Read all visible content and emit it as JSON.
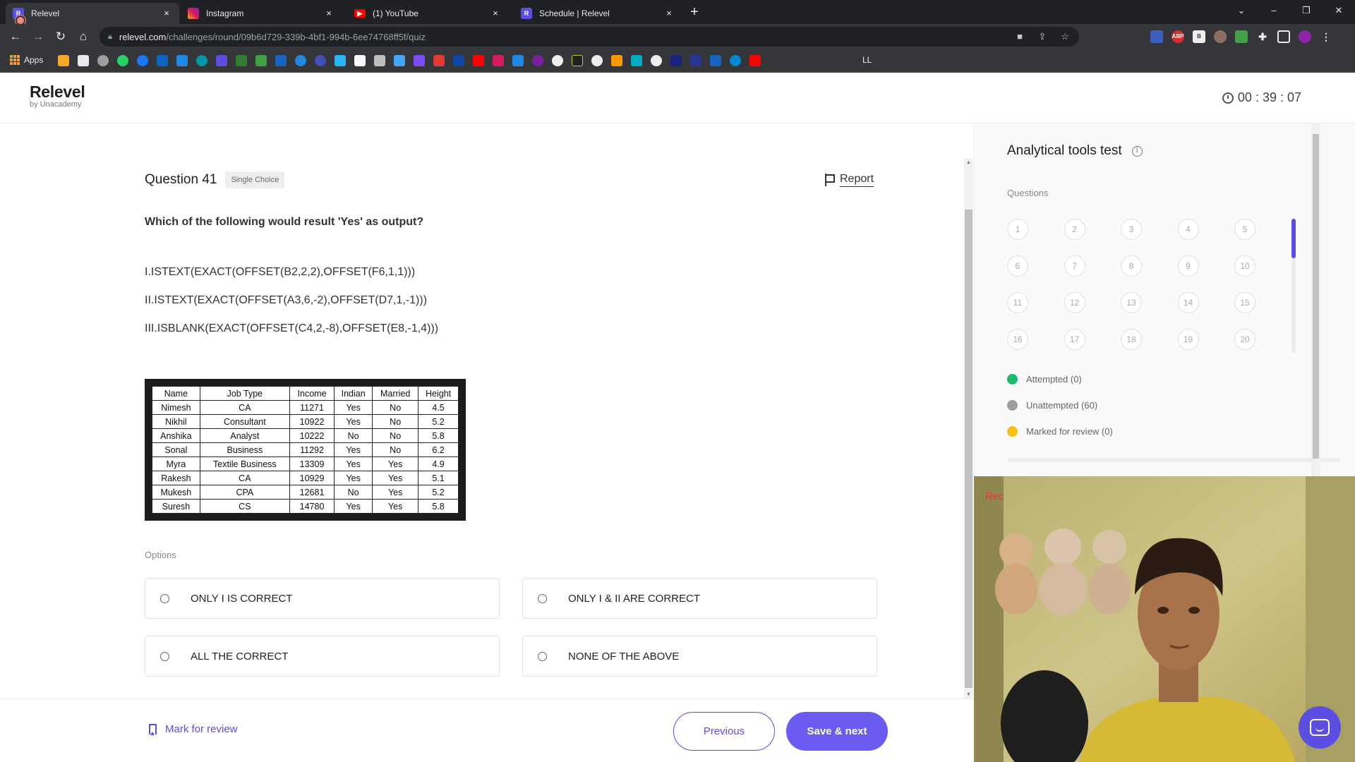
{
  "browser": {
    "tabs": [
      {
        "title": "Relevel",
        "favicon": "relevel-icon",
        "active": true,
        "recording": true
      },
      {
        "title": "Instagram",
        "favicon": "instagram-icon",
        "active": false
      },
      {
        "title": "(1) YouTube",
        "favicon": "youtube-icon",
        "active": false
      },
      {
        "title": "Schedule | Relevel",
        "favicon": "relevel-icon",
        "active": false
      }
    ],
    "url_host": "relevel.com",
    "url_path": "/challenges/round/09b6d729-339b-4bf1-994b-6ee74768ff5f/quiz",
    "bookmarks_apps_label": "Apps",
    "bookmark_ll_label": "LL",
    "tab_close_glyph": "×",
    "new_tab_glyph": "+",
    "window_controls": [
      "⌄",
      "–",
      "❐",
      "✕"
    ],
    "nav_glyphs": {
      "back": "←",
      "forward": "→",
      "reload": "↻",
      "home": "⌂",
      "menu": "⋮"
    }
  },
  "header": {
    "logo_name": "Relevel",
    "logo_sub": "by Unacademy",
    "timer": "00 : 39 : 07"
  },
  "question": {
    "title": "Question 41",
    "badge": "Single Choice",
    "report_label": "Report",
    "text": "Which of the following would result 'Yes' as output?",
    "formulas": [
      "I.ISTEXT(EXACT(OFFSET(B2,2,2),OFFSET(F6,1,1)))",
      "II.ISTEXT(EXACT(OFFSET(A3,6,-2),OFFSET(D7,1,-1)))",
      "III.ISBLANK(EXACT(OFFSET(C4,2,-8),OFFSET(E8,-1,4)))"
    ],
    "table": {
      "headers": [
        "Name",
        "Job Type",
        "Income",
        "Indian",
        "Married",
        "Height"
      ],
      "rows": [
        [
          "Nimesh",
          "CA",
          "11271",
          "Yes",
          "No",
          "4.5"
        ],
        [
          "Nikhil",
          "Consultant",
          "10922",
          "Yes",
          "No",
          "5.2"
        ],
        [
          "Anshika",
          "Analyst",
          "10222",
          "No",
          "No",
          "5.8"
        ],
        [
          "Sonal",
          "Business",
          "11292",
          "Yes",
          "No",
          "6.2"
        ],
        [
          "Myra",
          "Textile Business",
          "13309",
          "Yes",
          "Yes",
          "4.9"
        ],
        [
          "Rakesh",
          "CA",
          "10929",
          "Yes",
          "Yes",
          "5.1"
        ],
        [
          "Mukesh",
          "CPA",
          "12681",
          "No",
          "Yes",
          "5.2"
        ],
        [
          "Suresh",
          "CS",
          "14780",
          "Yes",
          "Yes",
          "5.8"
        ]
      ]
    },
    "options_label": "Options",
    "options": [
      "ONLY I IS CORRECT",
      "ONLY I & II ARE CORRECT",
      "ALL THE CORRECT",
      "NONE OF THE ABOVE"
    ]
  },
  "footer": {
    "mark_review_label": "Mark for review",
    "previous_label": "Previous",
    "next_label": "Save & next"
  },
  "panel": {
    "title": "Analytical tools test",
    "info_glyph": "i",
    "questions_label": "Questions",
    "question_numbers": [
      "1",
      "2",
      "3",
      "4",
      "5",
      "6",
      "7",
      "8",
      "9",
      "10",
      "11",
      "12",
      "13",
      "14",
      "15",
      "16",
      "17",
      "18",
      "19",
      "20"
    ],
    "legend": [
      {
        "label": "Attempted (0)",
        "color": "#1bb96d"
      },
      {
        "label": "Unattempted (60)",
        "color": "#9e9e9e"
      },
      {
        "label": "Marked for review (0)",
        "color": "#f5c211"
      }
    ]
  },
  "webcam": {
    "rec_label": "Rec"
  },
  "colors": {
    "accent": "#5a4fe0",
    "primary_button": "#6a5cf0"
  }
}
